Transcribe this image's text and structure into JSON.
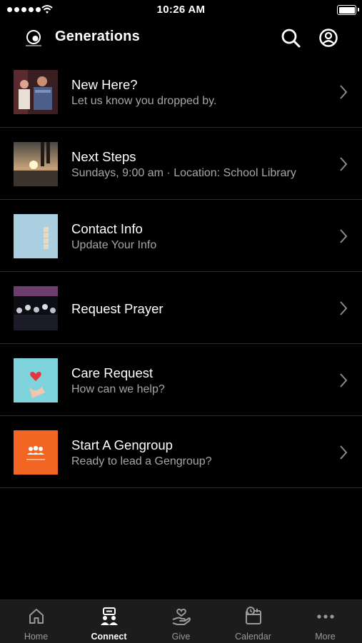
{
  "status_bar": {
    "time": "10:26 AM"
  },
  "header": {
    "title": "Generations"
  },
  "rows": [
    {
      "title": "New Here?",
      "subtitle": "Let us know you dropped by."
    },
    {
      "title": "Next Steps",
      "subtitle": "Sundays, 9:00 am · Location: School Library"
    },
    {
      "title": "Contact Info",
      "subtitle": "Update Your Info"
    },
    {
      "title": "Request Prayer",
      "subtitle": ""
    },
    {
      "title": "Care Request",
      "subtitle": "How can we help?"
    },
    {
      "title": "Start A Gengroup",
      "subtitle": "Ready to lead a Gengroup?"
    }
  ],
  "tabs": [
    {
      "label": "Home",
      "icon": "home-icon"
    },
    {
      "label": "Connect",
      "icon": "connect-icon",
      "active": true
    },
    {
      "label": "Give",
      "icon": "give-icon"
    },
    {
      "label": "Calendar",
      "icon": "calendar-icon"
    },
    {
      "label": "More",
      "icon": "more-icon"
    }
  ],
  "colors": {
    "background": "#000000",
    "tabbar": "#1c1c1c",
    "accent_orange": "#f26522",
    "subtitle": "#a6a6a6"
  }
}
